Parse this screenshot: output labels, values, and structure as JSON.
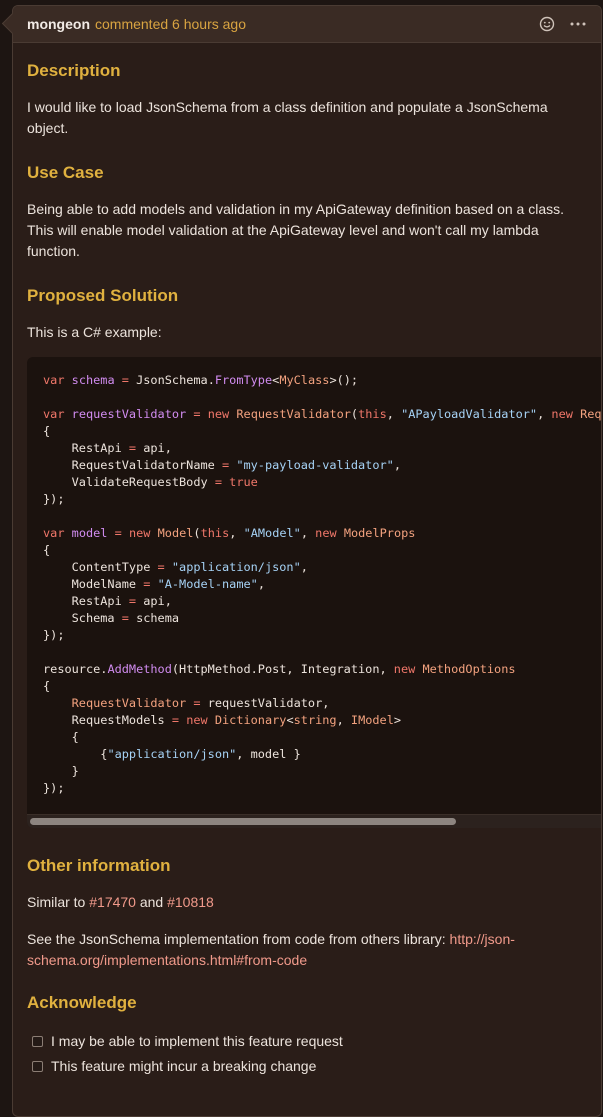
{
  "header": {
    "author": "mongeon",
    "action": "commented 6 hours ago"
  },
  "sections": {
    "description": {
      "heading": "Description",
      "text": "I would like to load JsonSchema from a class definition and populate a JsonSchema object."
    },
    "use_case": {
      "heading": "Use Case",
      "text": "Being able to add models and validation in my ApiGateway definition based on a class. This will enable model validation at the ApiGateway level and won't call my lambda function."
    },
    "proposed_solution": {
      "heading": "Proposed Solution",
      "intro": "This is a C# example:"
    },
    "other_information": {
      "heading": "Other information",
      "similar_prefix": "Similar to",
      "ref1": "#17470",
      "and": "and",
      "ref2": "#10818",
      "see_text": "See the JsonSchema implementation from code from others library:",
      "link": "http://json-schema.org/implementations.html#from-code"
    },
    "acknowledge": {
      "heading": "Acknowledge",
      "tasks": [
        {
          "label": "I may be able to implement this feature request",
          "checked": false
        },
        {
          "label": "This feature might incur a breaking change",
          "checked": false
        }
      ]
    }
  },
  "code": {
    "language": "C#",
    "lines": [
      "var schema = JsonSchema.FromType<MyClass>();",
      "",
      "var requestValidator = new RequestValidator(this, \"APayloadValidator\", new RequestValidatorProps",
      "{",
      "    RestApi = api,",
      "    RequestValidatorName = \"my-payload-validator\",",
      "    ValidateRequestBody = true",
      "});",
      "",
      "var model = new Model(this, \"AModel\", new ModelProps",
      "{",
      "    ContentType = \"application/json\",",
      "    ModelName = \"A-Model-name\",",
      "    RestApi = api,",
      "    Schema = schema",
      "});",
      "",
      "resource.AddMethod(HttpMethod.Post, Integration, new MethodOptions",
      "{",
      "    RequestValidator = requestValidator,",
      "    RequestModels = new Dictionary<string, IModel>",
      "    {",
      "        {\"application/json\", model }",
      "    }",
      "});"
    ]
  },
  "icons": {
    "reaction": "smiley-icon",
    "menu": "kebab-menu-icon"
  },
  "colors": {
    "heading": "#e0b13f",
    "link": "#f19a8b",
    "background": "#2a1d18"
  }
}
